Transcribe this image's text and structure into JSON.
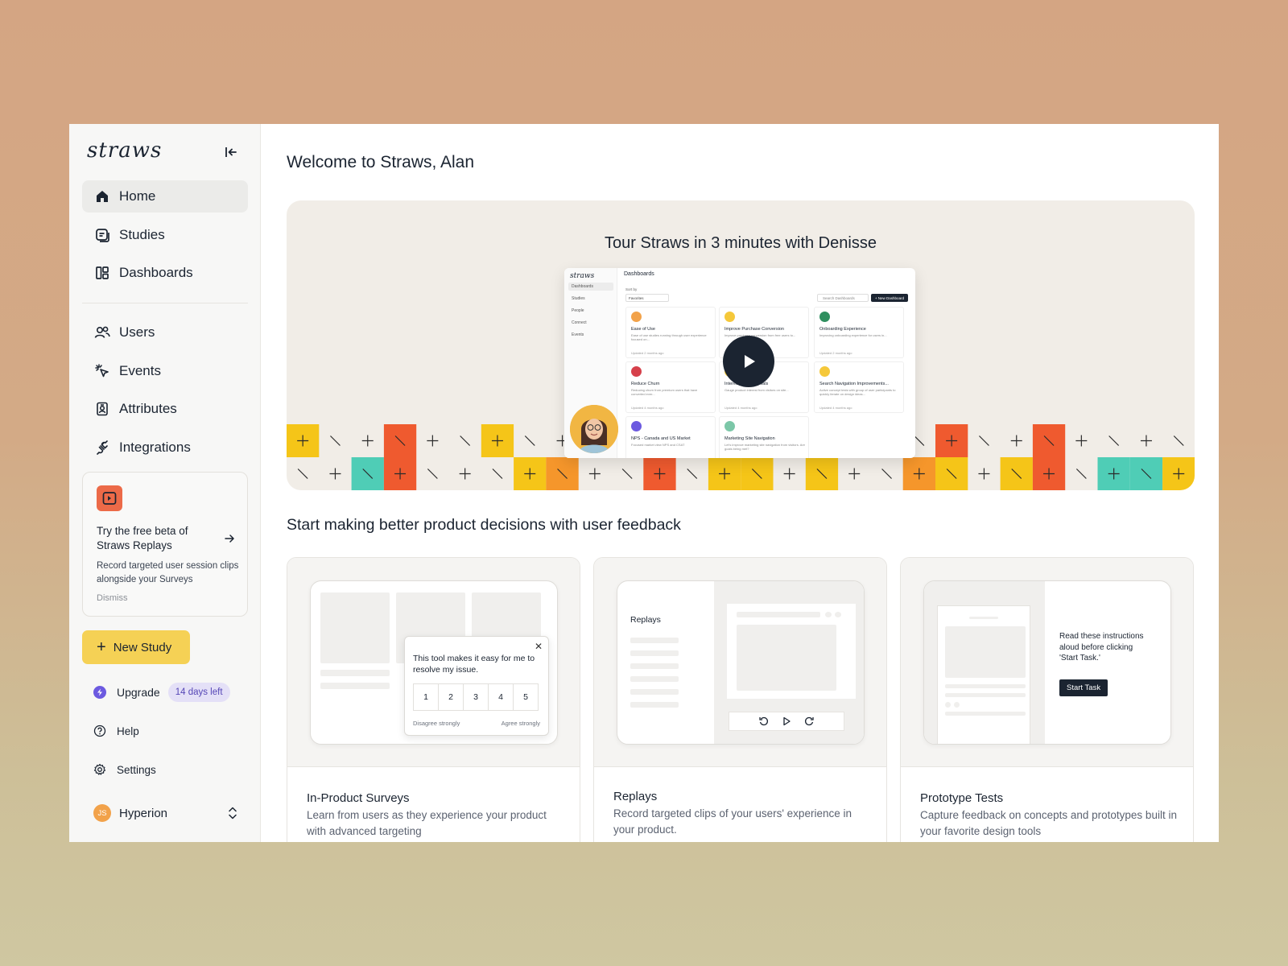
{
  "sidebar": {
    "logo": "straws",
    "nav_primary": [
      {
        "label": "Home",
        "icon": "home-icon",
        "active": true
      },
      {
        "label": "Studies",
        "icon": "studies-icon"
      },
      {
        "label": "Dashboards",
        "icon": "dashboards-icon"
      }
    ],
    "nav_secondary": [
      {
        "label": "Users",
        "icon": "users-icon"
      },
      {
        "label": "Events",
        "icon": "cursor-click-icon"
      },
      {
        "label": "Attributes",
        "icon": "badge-icon"
      },
      {
        "label": "Integrations",
        "icon": "plug-icon"
      }
    ],
    "beta_card": {
      "title": "Try the free beta of Straws Replays",
      "description": "Record targeted user session clips alongside your Surveys",
      "dismiss": "Dismiss"
    },
    "new_study": "New Study",
    "upgrade": {
      "label": "Upgrade",
      "badge": "14 days left"
    },
    "help": "Help",
    "settings": "Settings",
    "workspace": {
      "initials": "JS",
      "name": "Hyperion"
    }
  },
  "main": {
    "welcome": "Welcome to Straws, Alan",
    "hero": {
      "title": "Tour Straws in 3 minutes with Denisse",
      "preview": {
        "logo": "straws",
        "nav": [
          "Dashboards",
          "Studies",
          "People",
          "Connect",
          "Events"
        ],
        "heading": "Dashboards",
        "sort_label": "Sort by",
        "sort_value": "Favorites",
        "search_placeholder": "Search Dashboards",
        "new_button": "+ New Dashboard",
        "cards": [
          {
            "title": "Ease of Use",
            "desc": "Ease of use studies running through user experience focused on...",
            "updated": "Updated 2 months ago",
            "color": "#f2a24a"
          },
          {
            "title": "Improve Purchase Conversion",
            "desc": "Improve purchase conversion from free users to...",
            "updated": "Updated 2 months ago",
            "color": "#f5c83a"
          },
          {
            "title": "Onboarding Experience",
            "desc": "Improving onboarding experience for users in...",
            "updated": "Updated 2 months ago",
            "color": "#2f8f5f"
          },
          {
            "title": "Reduce Churn",
            "desc": "Reducing churn from premium users that have converted ever...",
            "updated": "Updated 4 months ago",
            "color": "#d6404b"
          },
          {
            "title": "Interest - Visitor Goals",
            "desc": "Gauge product interest from visitors on site...",
            "updated": "Updated 4 months ago",
            "color": "#f5c83a"
          },
          {
            "title": "Search Navigation Improvements...",
            "desc": "Active concept tests with group of user participants to quickly iterate on design ideas...",
            "updated": "Updated 4 months ago",
            "color": "#f5c83a"
          },
          {
            "title": "NPS - Canada and US Market",
            "desc": "Focused market view NPS and CSAT",
            "updated": "",
            "color": "#6c5ae0"
          },
          {
            "title": "Marketing Site Navigation",
            "desc": "Let's improve marketing site navigation from visitors. Are goals being met?",
            "updated": "",
            "color": "#7cc7a8"
          }
        ]
      }
    },
    "subheading": "Start making better product decisions with user feedback",
    "features": [
      {
        "title": "In-Product Surveys",
        "description": "Learn from users as they experience your product with advanced targeting",
        "survey_question": "This tool makes it easy for me to resolve my issue.",
        "scale": [
          "1",
          "2",
          "3",
          "4",
          "5"
        ],
        "scale_low": "Disagree strongly",
        "scale_high": "Agree strongly"
      },
      {
        "title": "Replays",
        "description": "Record targeted clips of your users' experience in your product.",
        "panel_label": "Replays"
      },
      {
        "title": "Prototype Tests",
        "description": "Capture feedback on concepts and prototypes built in your favorite design tools",
        "instructions": "Read these instructions aloud before clicking 'Start Task.'",
        "button": "Start Task"
      }
    ]
  },
  "colors": {
    "accent_yellow": "#f5d155",
    "brand_dark": "#1b2431",
    "orange": "#ec6a48",
    "purple": "#6c5ae0",
    "teal": "#4fcdb6"
  }
}
